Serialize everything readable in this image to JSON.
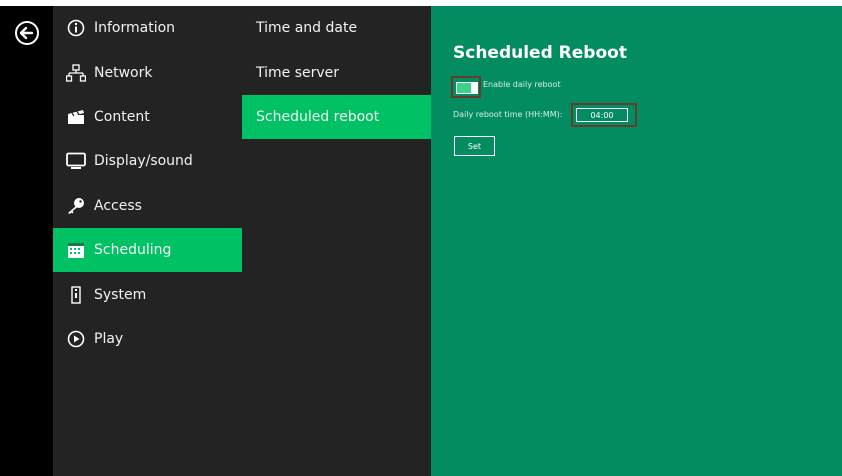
{
  "menu": {
    "items": [
      {
        "label": "Information",
        "icon": "info-icon"
      },
      {
        "label": "Network",
        "icon": "network-icon"
      },
      {
        "label": "Content",
        "icon": "clapperboard-icon"
      },
      {
        "label": "Display/sound",
        "icon": "monitor-icon"
      },
      {
        "label": "Access",
        "icon": "key-icon"
      },
      {
        "label": "Scheduling",
        "icon": "calendar-icon",
        "active": true
      },
      {
        "label": "System",
        "icon": "system-icon"
      },
      {
        "label": "Play",
        "icon": "play-icon"
      }
    ]
  },
  "submenu": {
    "items": [
      {
        "label": "Time and date"
      },
      {
        "label": "Time server"
      },
      {
        "label": "Scheduled reboot",
        "active": true
      }
    ]
  },
  "content": {
    "title": "Scheduled Reboot",
    "enable_label": "Enable daily reboot",
    "enable_checked": true,
    "time_label": "Daily reboot time (HH:MM):",
    "time_value": "04:00",
    "set_label": "Set"
  },
  "colors": {
    "accent": "#00c265",
    "panel_bg": "#038c62",
    "menu_bg": "#232323",
    "highlight_border": "#6a3a2a"
  }
}
